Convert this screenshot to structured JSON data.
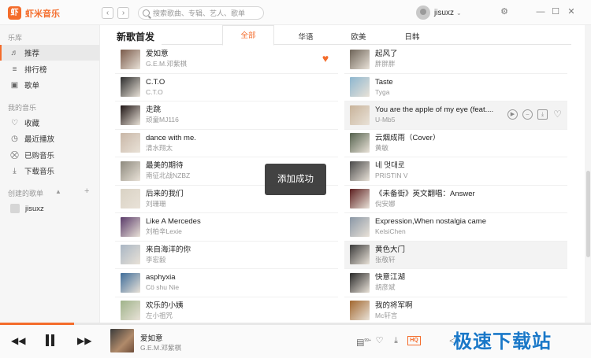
{
  "app": {
    "logo_badge": "虾",
    "name": "虾米音乐"
  },
  "nav": {
    "back": "‹",
    "forward": "›"
  },
  "search": {
    "placeholder": "搜索歌曲、专辑、艺人、歌单"
  },
  "user": {
    "name": "jisuxz"
  },
  "sidebar": {
    "section_library": "乐库",
    "library": [
      {
        "label": "推荐",
        "icon": "music-note-icon",
        "glyph": "♬"
      },
      {
        "label": "排行榜",
        "icon": "rank-icon",
        "glyph": "≡"
      },
      {
        "label": "歌单",
        "icon": "playlist-icon",
        "glyph": "▣"
      }
    ],
    "section_my": "我的音乐",
    "my": [
      {
        "label": "收藏",
        "icon": "heart-icon",
        "glyph": "♡"
      },
      {
        "label": "最近播放",
        "icon": "clock-icon",
        "glyph": "◷"
      },
      {
        "label": "已购音乐",
        "icon": "cart-icon",
        "glyph": "⛒"
      },
      {
        "label": "下载音乐",
        "icon": "download-icon",
        "glyph": "⤓"
      }
    ],
    "section_created": "创建的歌单",
    "playlist": "jisuxz"
  },
  "main": {
    "title": "新歌首发",
    "tabs": [
      "全部",
      "华语",
      "欧美",
      "日韩"
    ]
  },
  "songs_left": [
    {
      "title": "爱如意",
      "artist": "G.E.M.邓紫棋",
      "color": "#7a5a4a"
    },
    {
      "title": "C.T.O",
      "artist": "C.T.O",
      "color": "#2d2d2d"
    },
    {
      "title": "走跳",
      "artist": "顽童MJ116",
      "color": "#1e1414"
    },
    {
      "title": "dance with me.",
      "artist": "清水翔太",
      "color": "#c9b7a7"
    },
    {
      "title": "最美的期待",
      "artist": "南征北战NZBZ",
      "color": "#8e8a7e"
    },
    {
      "title": "后来的我们",
      "artist": "刘珊珊",
      "color": "#d9d2c4"
    },
    {
      "title": "Like A Mercedes",
      "artist": "刘柏辛Lexie",
      "color": "#5a3b6a"
    },
    {
      "title": "来自海洋的你",
      "artist": "李宏毅",
      "color": "#a9b6c4"
    },
    {
      "title": "asphyxia",
      "artist": "Cö shu Nie",
      "color": "#3f6d9a"
    },
    {
      "title": "欢乐的小姨",
      "artist": "左小祖咒",
      "color": "#9fb38a"
    }
  ],
  "songs_right": [
    {
      "title": "起风了",
      "artist": "胖胖胖",
      "color": "#6e6458"
    },
    {
      "title": "Taste",
      "artist": "Tyga",
      "color": "#8db6cf"
    },
    {
      "title": "You are the apple of my eye (feat....",
      "artist": "U-Mb5",
      "color": "#c8b39a"
    },
    {
      "title": "云烟成雨（Cover）",
      "artist": "黄敏",
      "color": "#55624e"
    },
    {
      "title": "네 멋대로",
      "artist": "PRISTIN V",
      "color": "#4a4a4a"
    },
    {
      "title": "《未备街》英文翻唱：Answer",
      "artist": "倪安娜",
      "color": "#5c1f1f"
    },
    {
      "title": "Expression,When nostalgia came",
      "artist": "KelsiChen",
      "color": "#8a97a6"
    },
    {
      "title": "黄色大门",
      "artist": "张敬轩",
      "color": "#3a3a3a"
    },
    {
      "title": "快意江湖",
      "artist": "胡彦斌",
      "color": "#2a2a2a"
    },
    {
      "title": "我的将军啊",
      "artist": "Mc轩言",
      "color": "#a2672f"
    }
  ],
  "toast": "添加成功",
  "player": {
    "now_title": "爱如意",
    "now_artist": "G.E.M.邓紫棋",
    "hq_label": "HQ",
    "comment_count": "99+",
    "progress": 0.125
  },
  "watermark": "极速下载站",
  "colors": {
    "accent": "#f46c2b"
  }
}
